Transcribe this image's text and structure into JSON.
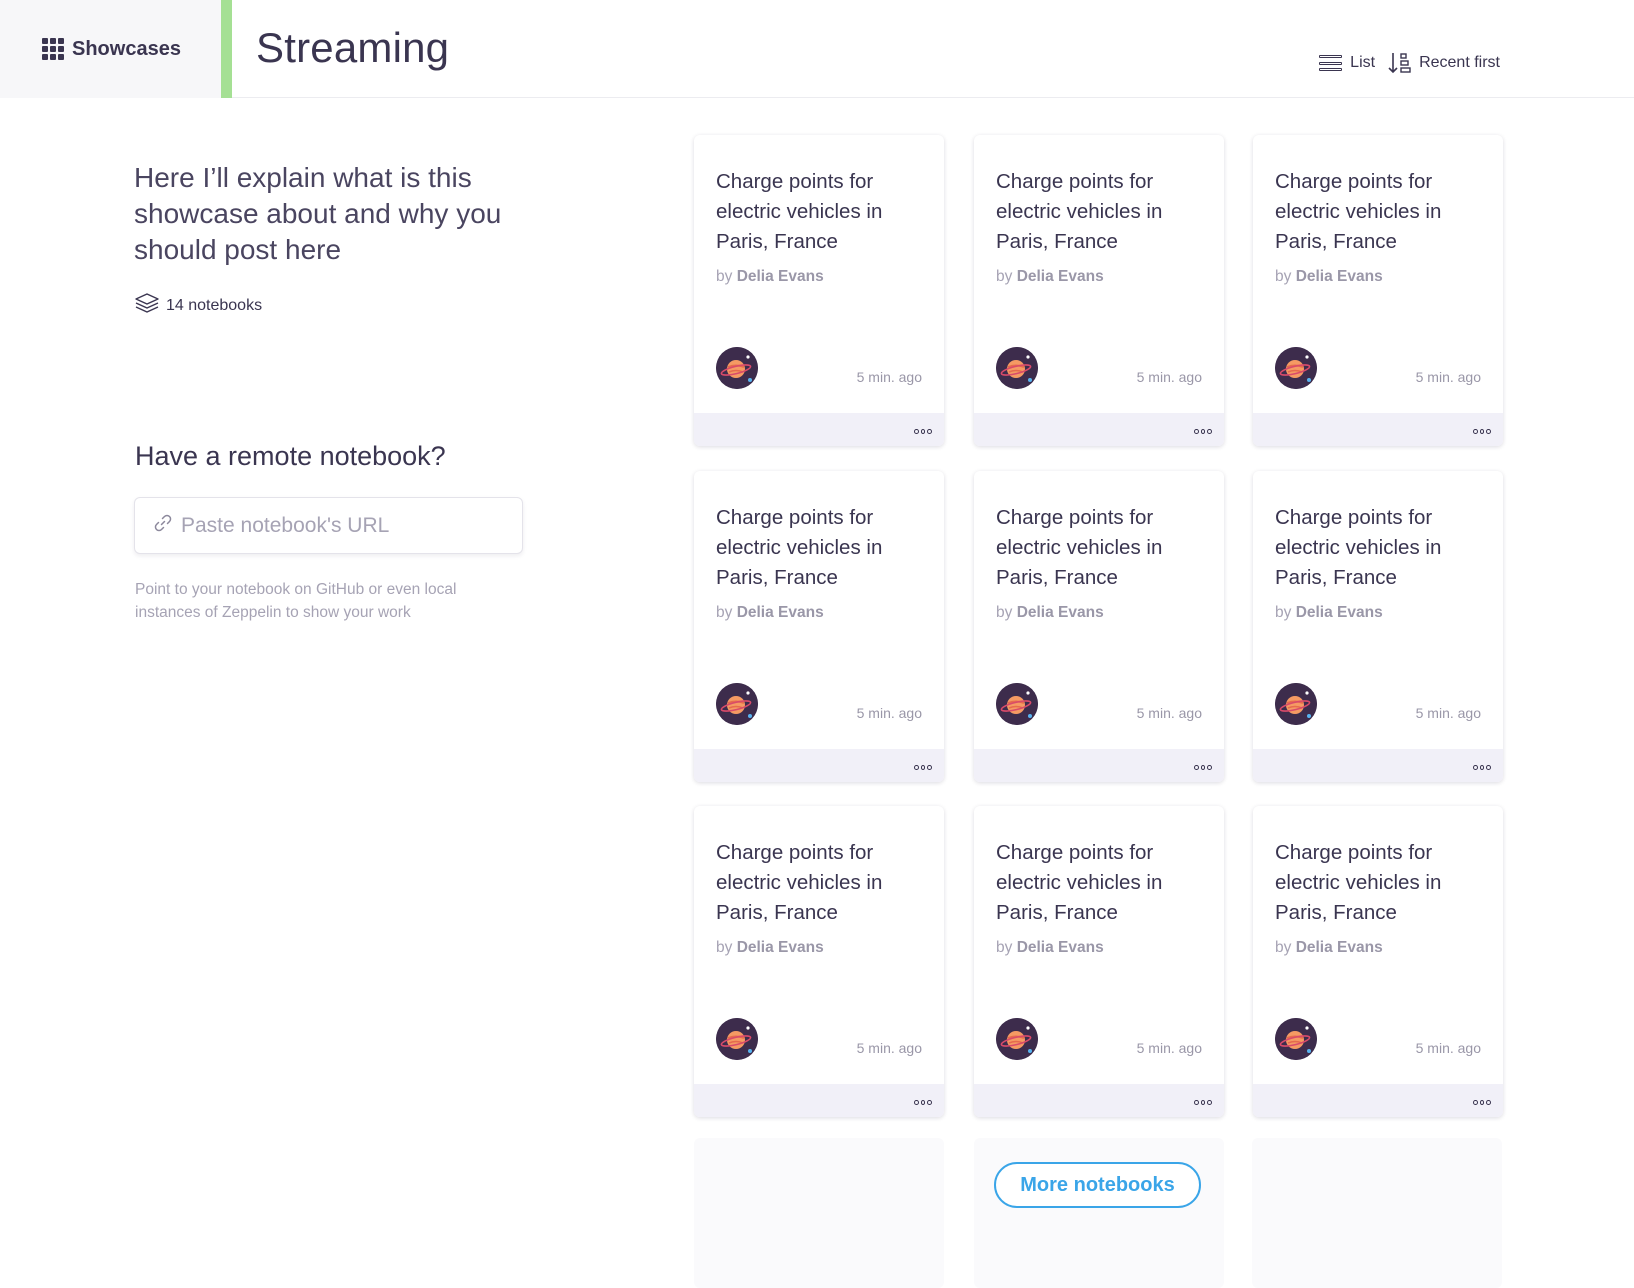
{
  "header": {
    "brand_label": "Showcases",
    "page_title": "Streaming",
    "view_label": "List",
    "sort_label": "Recent first",
    "accent_color": "#a5e094"
  },
  "sidebar": {
    "intro": "Here I’ll explain what is this showcase about and why you should post here",
    "count_label": "14 notebooks",
    "remote_title": "Have a remote notebook?",
    "url_placeholder": "Paste notebook's URL",
    "hint": "Point to your notebook on GitHub or even local instances of Zeppelin to show your work"
  },
  "cards": [
    {
      "title": "Charge points for electric vehicles in Paris, France",
      "by": "by",
      "author": "Delia Evans",
      "time": "5 min. ago"
    },
    {
      "title": "Charge points for electric vehicles in Paris, France",
      "by": "by",
      "author": "Delia Evans",
      "time": "5 min. ago"
    },
    {
      "title": "Charge points for electric vehicles in Paris, France",
      "by": "by",
      "author": "Delia Evans",
      "time": "5 min. ago"
    },
    {
      "title": "Charge points for electric vehicles in Paris, France",
      "by": "by",
      "author": "Delia Evans",
      "time": "5 min. ago"
    },
    {
      "title": "Charge points for electric vehicles in Paris, France",
      "by": "by",
      "author": "Delia Evans",
      "time": "5 min. ago"
    },
    {
      "title": "Charge points for electric vehicles in Paris, France",
      "by": "by",
      "author": "Delia Evans",
      "time": "5 min. ago"
    },
    {
      "title": "Charge points for electric vehicles in Paris, France",
      "by": "by",
      "author": "Delia Evans",
      "time": "5 min. ago"
    },
    {
      "title": "Charge points for electric vehicles in Paris, France",
      "by": "by",
      "author": "Delia Evans",
      "time": "5 min. ago"
    },
    {
      "title": "Charge points for electric vehicles in Paris, France",
      "by": "by",
      "author": "Delia Evans",
      "time": "5 min. ago"
    }
  ],
  "more_button": "More notebooks",
  "link_color": "#3aa5e8"
}
